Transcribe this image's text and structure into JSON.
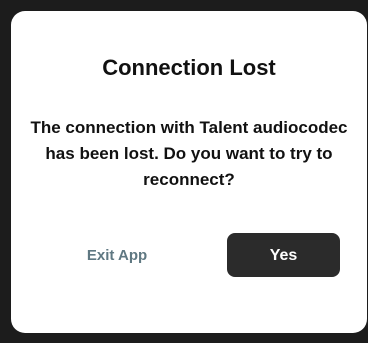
{
  "dialog": {
    "title": "Connection Lost",
    "message": "The connection with Talent audiocodec has been lost. Do you want to try to reconnect?",
    "exit_label": "Exit App",
    "yes_label": "Yes"
  },
  "colors": {
    "backdrop": "#1c1c1c",
    "dialog_background": "#ffffff",
    "text": "#111111",
    "exit_text": "#5f7882",
    "yes_background": "#2b2b2b",
    "yes_text": "#ffffff"
  }
}
